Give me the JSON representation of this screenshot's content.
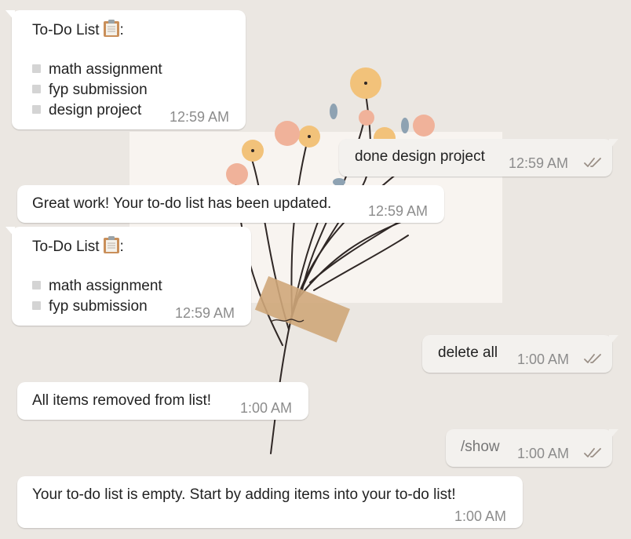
{
  "messages": [
    {
      "id": "todo-list-1",
      "direction": "incoming",
      "title": "To-Do List",
      "title_suffix": ":",
      "icon": "clipboard-icon",
      "items": [
        "math assignment",
        "fyp submission",
        "design project"
      ],
      "time": "12:59 AM"
    },
    {
      "id": "done-design",
      "direction": "outgoing",
      "text": "done design project",
      "time": "12:59 AM",
      "status": "read"
    },
    {
      "id": "great-work",
      "direction": "incoming",
      "text": "Great work! Your to-do list has been updated.",
      "time": "12:59 AM"
    },
    {
      "id": "todo-list-2",
      "direction": "incoming",
      "title": "To-Do List",
      "title_suffix": ":",
      "icon": "clipboard-icon",
      "items": [
        "math assignment",
        "fyp submission"
      ],
      "time": "12:59 AM"
    },
    {
      "id": "delete-all",
      "direction": "outgoing",
      "text": "delete all",
      "time": "1:00 AM",
      "status": "read"
    },
    {
      "id": "all-removed",
      "direction": "incoming",
      "text": "All items removed from list!",
      "time": "1:00 AM"
    },
    {
      "id": "show",
      "direction": "outgoing",
      "text": "/show",
      "time": "1:00 AM",
      "status": "read"
    },
    {
      "id": "empty-list",
      "direction": "incoming",
      "text": "Your to-do list is empty. Start by adding items into your to-do list!",
      "time": "1:00 AM"
    }
  ],
  "colors": {
    "chat_background": "#ebe7e2",
    "incoming_bubble": "#ffffff",
    "outgoing_bubble": "#f3f1ee",
    "timestamp": "#8c8c8c",
    "read_ticks": "#9a8f86"
  }
}
